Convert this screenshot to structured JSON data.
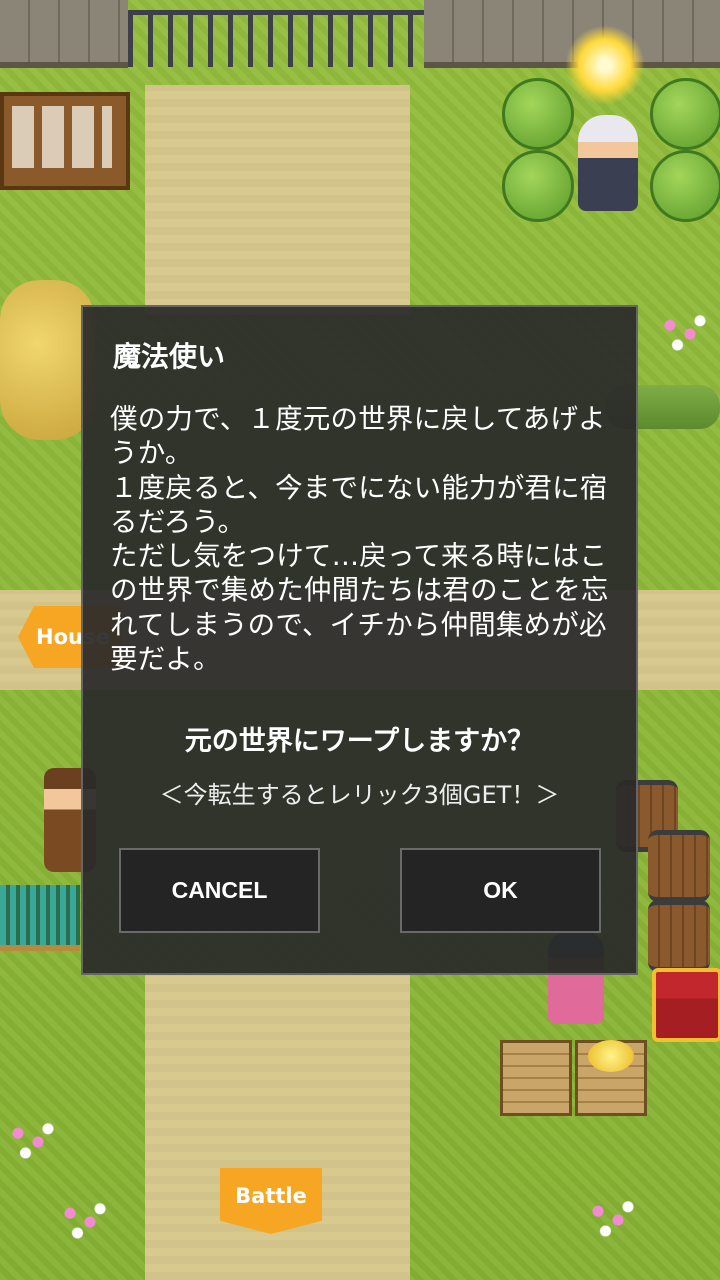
{
  "map": {
    "signs": {
      "house": "House",
      "battle": "Battle"
    }
  },
  "dialog": {
    "speaker": "魔法使い",
    "message": "僕の力で、１度元の世界に戻してあげようか。\n１度戻ると、今までにない能力が君に宿るだろう。\nただし気をつけて…戻って来る時にはこの世界で集めた仲間たちは君のことを忘れてしまうので、イチから仲間集めが必要だよ。",
    "question": "元の世界にワープしますか？",
    "bonus": "＜今転生するとレリック3個GET！＞",
    "buttons": {
      "cancel": "CANCEL",
      "ok": "OK"
    }
  }
}
